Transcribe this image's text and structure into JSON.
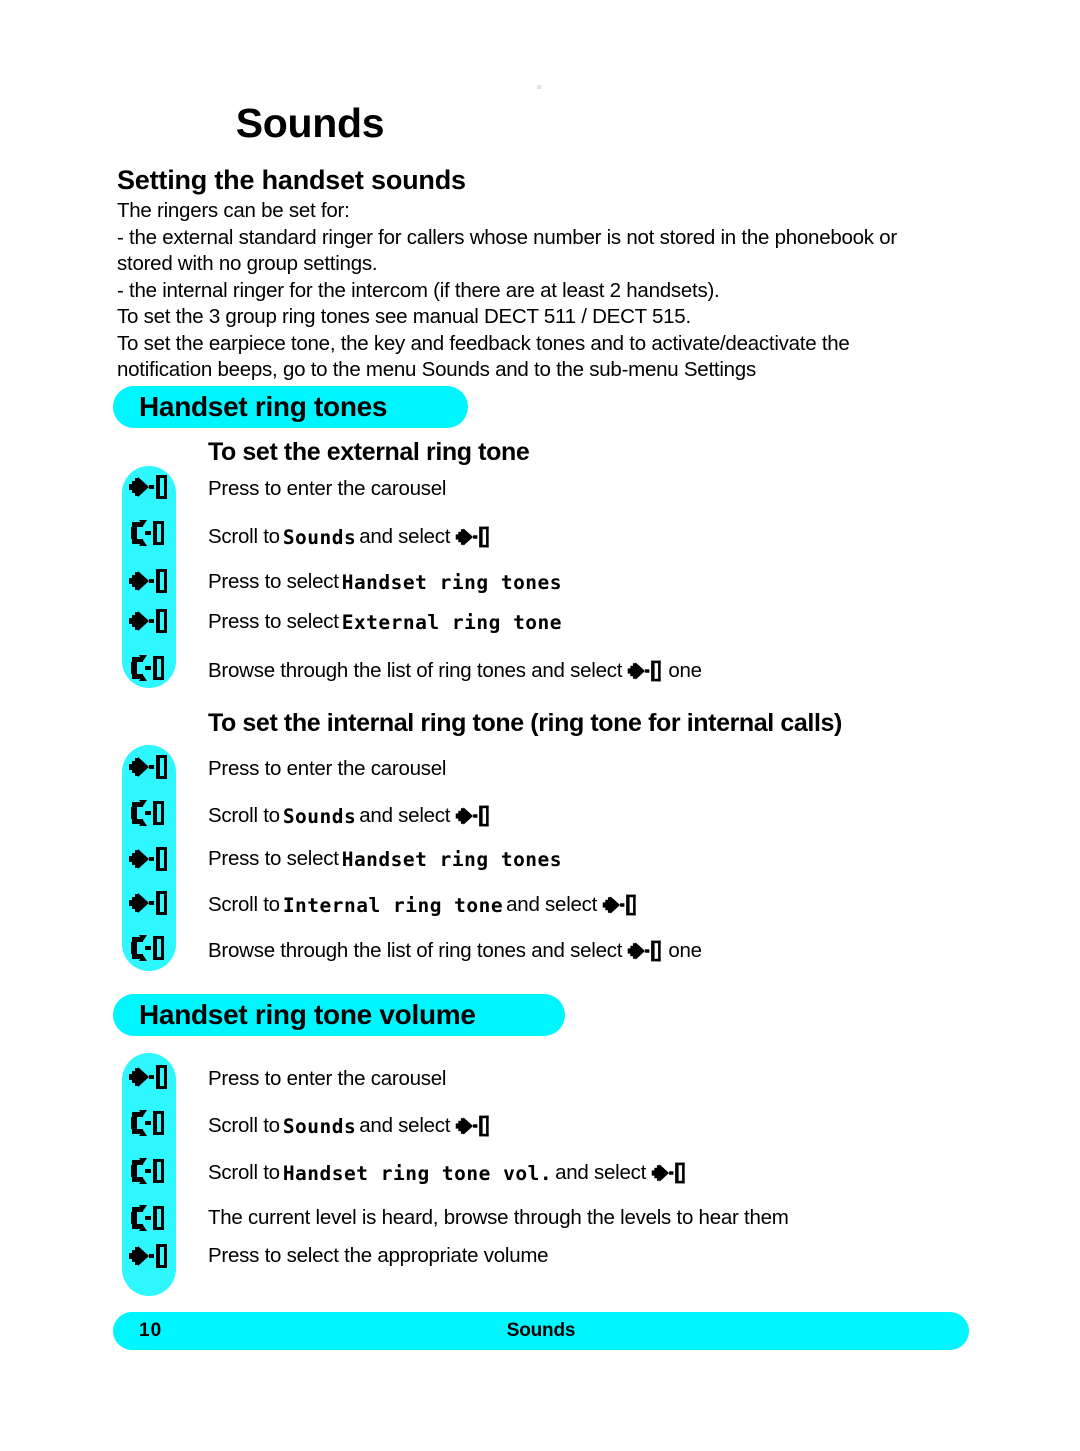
{
  "document": {
    "title": "Sounds",
    "section_title": "Setting the handset sounds"
  },
  "intro": {
    "line1": "The ringers can be set for:",
    "line2": "- the external standard ringer for callers whose number is not stored in the phonebook or stored with no group settings.",
    "line3": "- the internal ringer for the intercom (if there are at least 2 handsets).",
    "line4": "To set the 3 group ring tones see manual DECT 511 / DECT 515.",
    "line5": "To set the earpiece tone, the key and feedback tones and to activate/deactivate the notification beeps, go to the menu Sounds and to the sub-menu Settings"
  },
  "banners": {
    "ring_tones": "Handset ring tones",
    "ring_tone_volume": "Handset ring tone volume"
  },
  "sections": {
    "external": {
      "heading": "To set the external ring tone",
      "steps": [
        {
          "icon": "select-icon",
          "pre": "Press to enter the carousel",
          "menu": "",
          "post": "",
          "trailing_icon": "",
          "tail": ""
        },
        {
          "icon": "scroll-icon",
          "pre": "Scroll to ",
          "menu": "Sounds",
          "post": " and select ",
          "trailing_icon": "select-icon",
          "tail": ""
        },
        {
          "icon": "select-icon",
          "pre": "Press to select ",
          "menu": "Handset ring tones",
          "post": "",
          "trailing_icon": "",
          "tail": ""
        },
        {
          "icon": "select-icon",
          "pre": "Press to select ",
          "menu": "External ring tone",
          "post": "",
          "trailing_icon": "",
          "tail": ""
        },
        {
          "icon": "scroll-icon",
          "pre": "Browse through the list of ring tones and select ",
          "menu": "",
          "post": "",
          "trailing_icon": "select-icon",
          "tail": " one"
        }
      ]
    },
    "internal": {
      "heading": "To set the internal ring tone (ring tone for internal calls)",
      "steps": [
        {
          "icon": "select-icon",
          "pre": "Press to enter the carousel",
          "menu": "",
          "post": "",
          "trailing_icon": "",
          "tail": ""
        },
        {
          "icon": "scroll-icon",
          "pre": "Scroll to ",
          "menu": "Sounds",
          "post": " and select ",
          "trailing_icon": "select-icon",
          "tail": ""
        },
        {
          "icon": "select-icon",
          "pre": "Press to select ",
          "menu": "Handset ring tones",
          "post": "",
          "trailing_icon": "",
          "tail": ""
        },
        {
          "icon": "select-icon",
          "pre": "Scroll to ",
          "menu": "Internal ring tone",
          "post": " and select ",
          "trailing_icon": "select-icon",
          "tail": ""
        },
        {
          "icon": "scroll-icon",
          "pre": "Browse through the list of ring tones and select ",
          "menu": "",
          "post": "",
          "trailing_icon": "select-icon",
          "tail": " one"
        }
      ]
    },
    "volume": {
      "heading": "",
      "steps": [
        {
          "icon": "select-icon",
          "pre": "Press to enter the carousel",
          "menu": "",
          "post": "",
          "trailing_icon": "",
          "tail": ""
        },
        {
          "icon": "scroll-icon",
          "pre": "Scroll to ",
          "menu": "Sounds",
          "post": " and select ",
          "trailing_icon": "select-icon",
          "tail": ""
        },
        {
          "icon": "scroll-icon",
          "pre": "Scroll to ",
          "menu": "Handset ring tone vol.",
          "post": " and select ",
          "trailing_icon": "select-icon",
          "tail": ""
        },
        {
          "icon": "scroll-icon",
          "pre": "The current level is heard, browse through the levels to hear them",
          "menu": "",
          "post": "",
          "trailing_icon": "",
          "tail": ""
        },
        {
          "icon": "select-icon",
          "pre": "Press to select the appropriate volume",
          "menu": "",
          "post": "",
          "trailing_icon": "",
          "tail": ""
        }
      ]
    }
  },
  "footer": {
    "page_number": "10",
    "name": "Sounds"
  },
  "colors": {
    "banner_cyan": "#00f6ff",
    "rail_cyan": "#2ff7ff",
    "text": "#000000"
  }
}
